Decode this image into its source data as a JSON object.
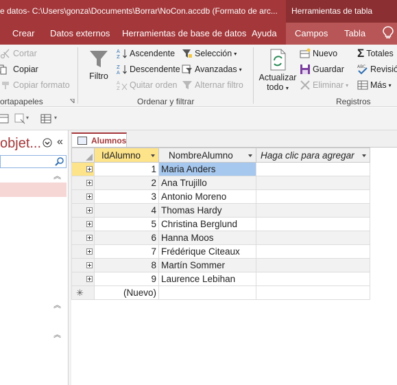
{
  "titlebar": {
    "title": "e datos- C:\\Users\\gonza\\Documents\\Borrar\\NoCon.accdb (Formato de arc...",
    "context_label": "Herramientas de tabla"
  },
  "tabs": [
    "Crear",
    "Datos externos",
    "Herramientas de base de datos",
    "Ayuda",
    "Campos",
    "Tabla"
  ],
  "ribbon": {
    "portapapeles": {
      "cortar": "Cortar",
      "copiar": "Copiar",
      "copiar_formato": "Copiar formato",
      "label": "ortapapeles"
    },
    "ordenar": {
      "filtro": "Filtro",
      "ascendente": "Ascendente",
      "descendente": "Descendente",
      "quitar_orden": "Quitar orden",
      "seleccion": "Selección",
      "avanzadas": "Avanzadas",
      "alternar_filtro": "Alternar filtro",
      "label": "Ordenar y filtrar"
    },
    "registros": {
      "actualizar": "Actualizar",
      "todo": "todo",
      "nuevo": "Nuevo",
      "guardar": "Guardar",
      "eliminar": "Eliminar",
      "totales": "Totales",
      "revision": "Revisió",
      "mas": "Más",
      "label": "Registros"
    }
  },
  "nav": {
    "title": "objet..."
  },
  "document": {
    "tab_label": "Alumnos"
  },
  "table": {
    "columns": [
      "IdAlumno",
      "NombreAlumno",
      "Haga clic para agregar"
    ],
    "rows": [
      {
        "id": "1",
        "name": "Maria Anders"
      },
      {
        "id": "2",
        "name": "Ana Trujillo"
      },
      {
        "id": "3",
        "name": "Antonio Moreno"
      },
      {
        "id": "4",
        "name": "Thomas Hardy"
      },
      {
        "id": "5",
        "name": "Christina Berglund"
      },
      {
        "id": "6",
        "name": "Hanna Moos"
      },
      {
        "id": "7",
        "name": "Frédérique Citeaux"
      },
      {
        "id": "8",
        "name": "Martín Sommer"
      },
      {
        "id": "9",
        "name": "Laurence Lebihan"
      }
    ],
    "new_row_label": "(Nuevo)"
  },
  "colors": {
    "accent": "#a4373a",
    "selection": "#a6c8ee",
    "record_selector": "#fde38a"
  }
}
